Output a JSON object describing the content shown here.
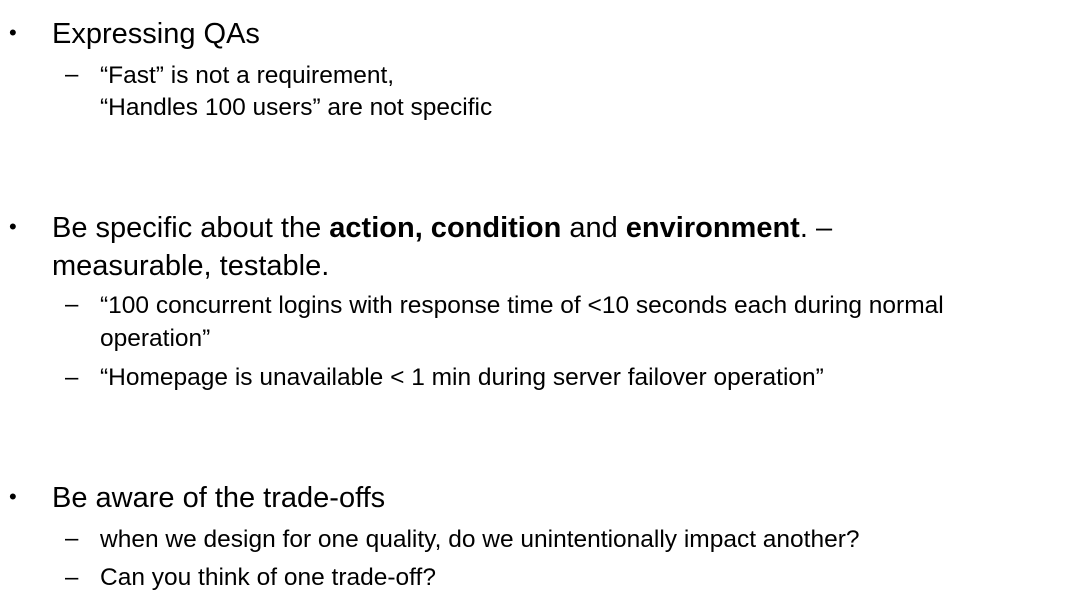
{
  "bullet_symbol": "•",
  "dash_symbol": "–",
  "section1": {
    "heading": "Expressing QAs",
    "sub1_line1": "“Fast” is not a requirement,",
    "sub1_line2": "“Handles 100 users” are not specific"
  },
  "section2": {
    "heading_pre": "Be specific about the ",
    "heading_bold1": "action, condition",
    "heading_mid": " and ",
    "heading_bold2": "environment",
    "heading_post": ". –",
    "heading_line2": "measurable, testable.",
    "sub1_line1": "“100 concurrent logins with response time of <10 seconds each during normal",
    "sub1_line2": "operation”",
    "sub2": "“Homepage is unavailable < 1 min during server failover operation”"
  },
  "section3": {
    "heading": "Be aware of the trade-offs",
    "sub1": "when we design for one quality, do we unintentionally impact another?",
    "sub2": "Can you think of one trade-off?"
  }
}
